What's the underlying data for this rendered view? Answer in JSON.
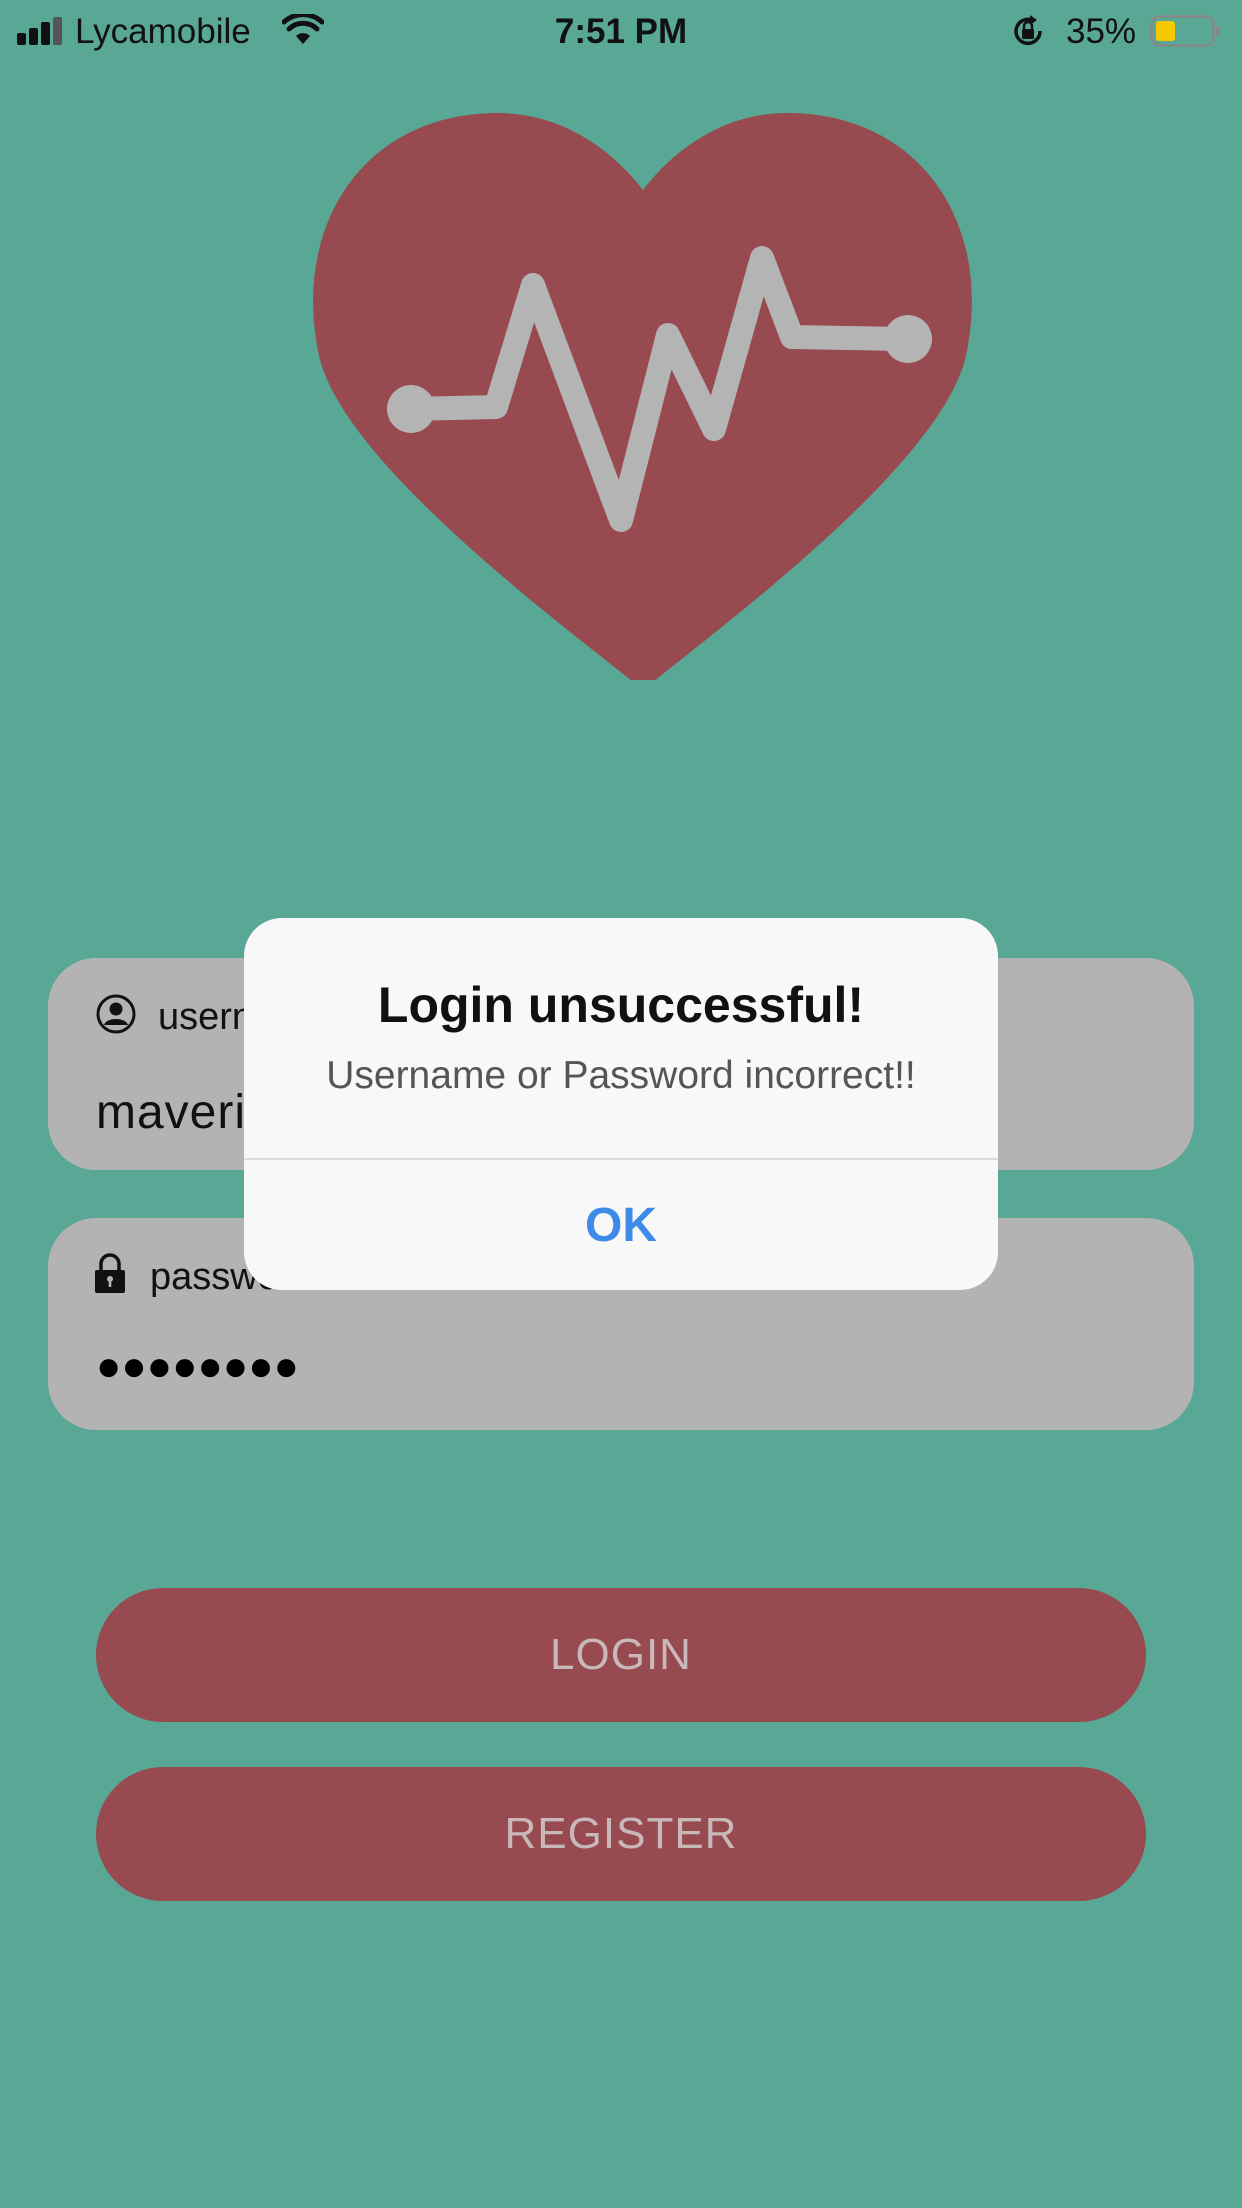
{
  "status_bar": {
    "carrier": "Lycamobile",
    "time": "7:51 PM",
    "battery_percent": "35%",
    "battery_level": 0.35,
    "icons": [
      "signal-icon",
      "wifi-icon",
      "rotation-lock-icon",
      "battery-icon"
    ]
  },
  "logo": {
    "icon": "heart-heartbeat-icon"
  },
  "username_field": {
    "icon": "user-icon",
    "label": "username",
    "value": "maverick"
  },
  "password_field": {
    "icon": "lock-icon",
    "label": "password",
    "masked_value": "●●●●●●●●"
  },
  "buttons": {
    "login": "LOGIN",
    "register": "REGISTER"
  },
  "alert": {
    "title": "Login unsuccessful!",
    "message": "Username or Password incorrect!!",
    "ok": "OK"
  },
  "colors": {
    "background": "#53988a",
    "pattern": "#5aa996",
    "heart": "#974a4f",
    "field": "#b3b3b3",
    "button": "#974a4f",
    "button_text": "#c8b8b9",
    "alert_action": "#3e8ae8",
    "battery_fill": "#f5c800"
  }
}
